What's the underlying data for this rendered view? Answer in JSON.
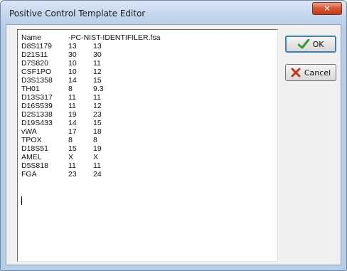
{
  "window": {
    "title": "Positive Control Template Editor",
    "close_glyph": "✕"
  },
  "editor": {
    "lines": [
      {
        "marker": "Name",
        "a": "-PC-NIST-IDENTIFILER.fsa",
        "b": ""
      },
      {
        "marker": "D8S1179",
        "a": "13",
        "b": "13"
      },
      {
        "marker": "D21S11",
        "a": "30",
        "b": "30"
      },
      {
        "marker": "D7S820",
        "a": "10",
        "b": "11"
      },
      {
        "marker": "CSF1PO",
        "a": "10",
        "b": "12"
      },
      {
        "marker": "D3S1358",
        "a": "14",
        "b": "15"
      },
      {
        "marker": "TH01",
        "a": "8",
        "b": "9.3"
      },
      {
        "marker": "D13S317",
        "a": "11",
        "b": "11"
      },
      {
        "marker": "D16S539",
        "a": "11",
        "b": "12"
      },
      {
        "marker": "D2S1338",
        "a": "19",
        "b": "23"
      },
      {
        "marker": "D19S433",
        "a": "14",
        "b": "15"
      },
      {
        "marker": "vWA",
        "a": "17",
        "b": "18"
      },
      {
        "marker": "TPOX",
        "a": "8",
        "b": "8"
      },
      {
        "marker": "D18S51",
        "a": "15",
        "b": "19"
      },
      {
        "marker": "AMEL",
        "a": "X",
        "b": "X"
      },
      {
        "marker": "D5S818",
        "a": "11",
        "b": "11"
      },
      {
        "marker": "FGA",
        "a": "23",
        "b": "24"
      }
    ]
  },
  "buttons": {
    "ok_label": "OK",
    "ok_icon": "checkmark-icon",
    "cancel_label": "Cancel",
    "cancel_icon": "x-mark-icon"
  },
  "colors": {
    "ok_check": "#2f9a2f",
    "cancel_x": "#c8321e"
  }
}
